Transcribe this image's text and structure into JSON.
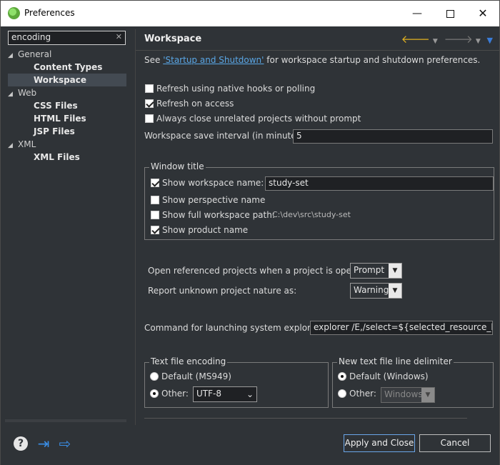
{
  "window": {
    "title": "Preferences"
  },
  "filter": {
    "value": "encoding",
    "clear": "✕"
  },
  "tree": {
    "general": "General",
    "content_types": "Content Types",
    "workspace": "Workspace",
    "web": "Web",
    "css_files": "CSS Files",
    "html_files": "HTML Files",
    "jsp_files": "JSP Files",
    "xml": "XML",
    "xml_files": "XML Files"
  },
  "page": {
    "title": "Workspace",
    "intro_prefix": "See ",
    "intro_link": "'Startup and Shutdown'",
    "intro_suffix": " for workspace startup and shutdown preferences.",
    "refresh_native": "Refresh using native hooks or polling",
    "refresh_native_checked": false,
    "refresh_access": "Refresh on access",
    "refresh_access_checked": true,
    "always_close": "Always close unrelated projects without prompt",
    "always_close_checked": false,
    "save_interval_label": "Workspace save interval (in minutes):",
    "save_interval_value": "5",
    "window_title": {
      "legend": "Window title",
      "show_workspace_name": "Show workspace name:",
      "show_workspace_name_checked": true,
      "workspace_name_value": "study-set",
      "show_perspective": "Show perspective name",
      "show_perspective_checked": false,
      "show_full_path": "Show full workspace path:",
      "show_full_path_checked": false,
      "full_path_value": "C:\\dev\\src\\study-set",
      "show_product": "Show product name",
      "show_product_checked": true
    },
    "open_referenced_label": "Open referenced projects when a project is opened:",
    "open_referenced_value": "Prompt",
    "report_unknown_label": "Report unknown project nature as:",
    "report_unknown_value": "Warning",
    "explorer_label": "Command for launching system explorer:",
    "explorer_value": "explorer /E,/select=${selected_resource_loc}",
    "text_encoding": {
      "legend": "Text file encoding",
      "default_label": "Default (MS949)",
      "other_label": "Other:",
      "other_value": "UTF-8",
      "selected": "other"
    },
    "line_delimiter": {
      "legend": "New text file line delimiter",
      "default_label": "Default (Windows)",
      "other_label": "Other:",
      "other_value": "Windows",
      "selected": "default"
    }
  },
  "buttons": {
    "apply_close": "Apply and Close",
    "cancel": "Cancel"
  },
  "colors": {
    "background": "#2f3337",
    "link": "#5aa7e6",
    "accent": "#3a8fe8"
  }
}
